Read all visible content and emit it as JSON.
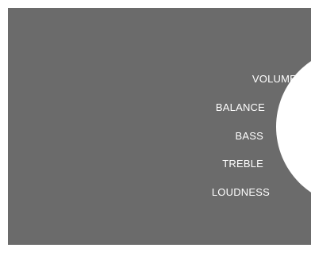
{
  "menu": {
    "items": [
      {
        "label": "VOLUME"
      },
      {
        "label": "BALANCE"
      },
      {
        "label": "BASS"
      },
      {
        "label": "TREBLE"
      },
      {
        "label": "LOUDNESS"
      }
    ]
  },
  "colors": {
    "panel_background": "#6b6b6b",
    "dial": "#ffffff",
    "text": "#ffffff"
  }
}
